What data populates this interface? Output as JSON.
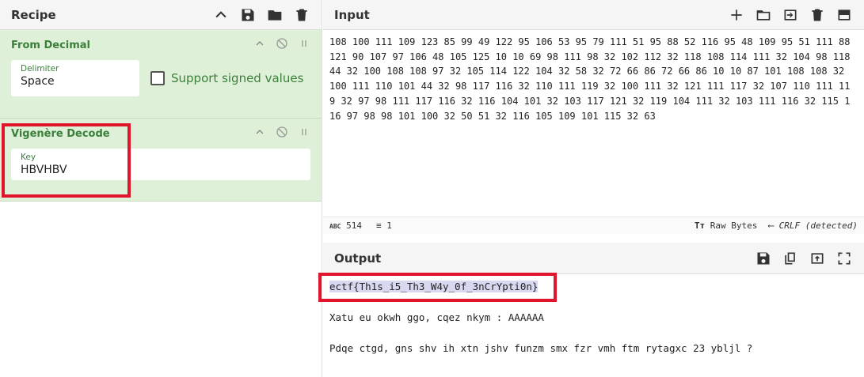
{
  "recipe": {
    "title": "Recipe",
    "ops": [
      {
        "title": "From Decimal",
        "field_label": "Delimiter",
        "field_value": "Space",
        "checkbox_label": "Support signed values"
      },
      {
        "title": "Vigenère Decode",
        "field_label": "Key",
        "field_value": "HBVHBV"
      }
    ]
  },
  "input": {
    "title": "Input",
    "text": "108 100 111 109 123 85 99 49 122 95 106 53 95 79 111 51 95 88 52 116 95 48 109 95 51 111 88 121 90 107 97 106 48 105 125 10 10 69 98 111 98 32 102 112 32 118 108 114 111 32 104 98 118 44 32 100 108 108 97 32 105 114 122 104 32 58 32 72 66 86 72 66 86 10 10 87 101 108 108 32 100 111 110 101 44 32 98 117 116 32 110 111 119 32 100 111 32 121 111 117 32 107 110 111 119 32 97 98 111 117 116 32 116 104 101 32 103 117 121 32 119 104 111 32 103 111 116 32 115 116 97 98 98 101 100 32 50 51 32 116 105 109 101 115 32 63",
    "status": {
      "char_count": "514",
      "line_count": "1",
      "raw_bytes": "Raw Bytes",
      "eol": "CRLF (detected)"
    }
  },
  "output": {
    "title": "Output",
    "lines": [
      "ectf{Th1s_i5_Th3_W4y_0f_3nCrYpti0n}",
      "Xatu eu okwh ggo, cqez nkym : AAAAAA",
      "Pdqe ctgd, gns shv ih xtn jshv funzm smx fzr vmh ftm rytagxc 23 ybljl ?"
    ]
  },
  "icons": {
    "recipe": [
      "chevron-up-icon",
      "save-icon",
      "folder-icon",
      "trash-icon"
    ],
    "input": [
      "plus-icon",
      "folder-icon",
      "import-icon",
      "trash-icon",
      "layout-icon"
    ],
    "output": [
      "save-icon",
      "copy-icon",
      "replace-input-icon",
      "maximize-icon"
    ]
  },
  "colors": {
    "op_bg": "#dff0d8",
    "op_title": "#3a7f3a",
    "highlight_box": "#e0142a"
  }
}
